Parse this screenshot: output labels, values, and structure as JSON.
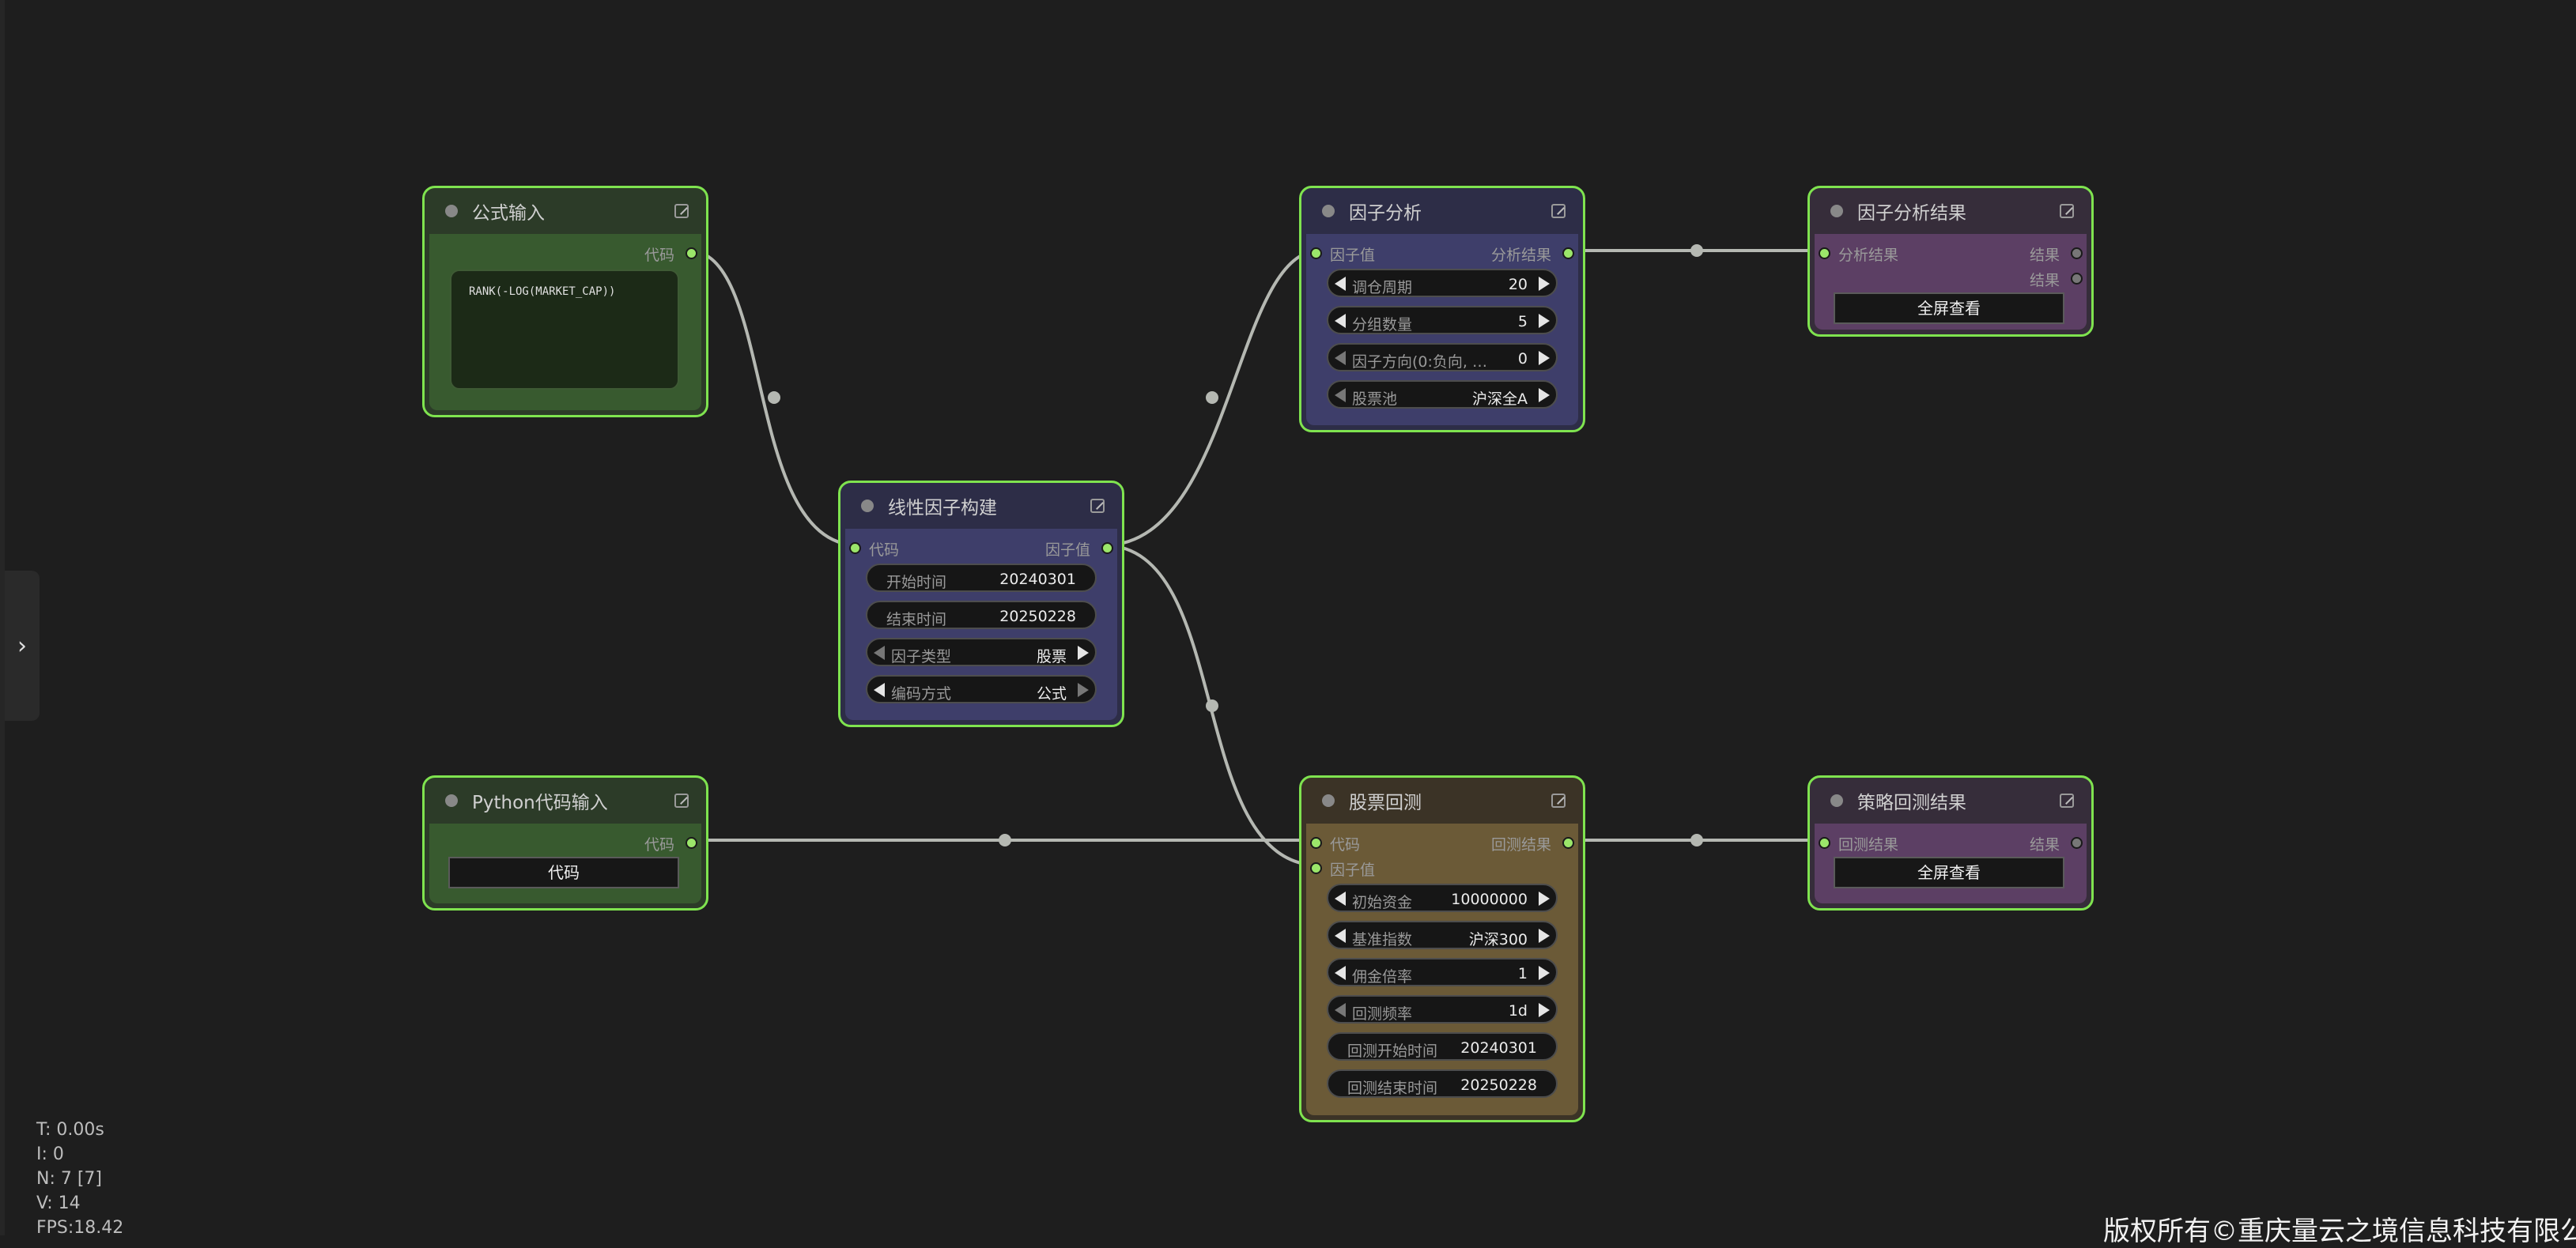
{
  "nodes": {
    "formula_input": {
      "title": "公式输入",
      "output_label": "代码",
      "formula_text": "RANK(-LOG(MARKET_CAP))"
    },
    "python_input": {
      "title": "Python代码输入",
      "output_label": "代码",
      "button_label": "代码"
    },
    "linear_factor": {
      "title": "线性因子构建",
      "input_label": "代码",
      "output_label": "因子值",
      "widgets": [
        {
          "label": "开始时间",
          "value": "20240301"
        },
        {
          "label": "结束时间",
          "value": "20250228"
        },
        {
          "label": "因子类型",
          "value": "股票"
        },
        {
          "label": "编码方式",
          "value": "公式"
        }
      ]
    },
    "factor_analysis": {
      "title": "因子分析",
      "input_label": "因子值",
      "output_label": "分析结果",
      "widgets": [
        {
          "label": "调仓周期",
          "value": "20"
        },
        {
          "label": "分组数量",
          "value": "5"
        },
        {
          "label": "因子方向(0:负向, …",
          "value": "0"
        },
        {
          "label": "股票池",
          "value": "沪深全A"
        }
      ]
    },
    "factor_result": {
      "title": "因子分析结果",
      "input_label": "分析结果",
      "output_label_1": "结果",
      "output_label_2": "结果",
      "button_label": "全屏查看"
    },
    "stock_backtest": {
      "title": "股票回测",
      "input_label_1": "代码",
      "input_label_2": "因子值",
      "output_label": "回测结果",
      "widgets": [
        {
          "label": "初始资金",
          "value": "10000000"
        },
        {
          "label": "基准指数",
          "value": "沪深300"
        },
        {
          "label": "佣金倍率",
          "value": "1"
        },
        {
          "label": "回测频率",
          "value": "1d"
        },
        {
          "label": "回测开始时间",
          "value": "20240301"
        },
        {
          "label": "回测结束时间",
          "value": "20250228"
        }
      ]
    },
    "strategy_result": {
      "title": "策略回测结果",
      "input_label": "回测结果",
      "output_label": "结果",
      "button_label": "全屏查看"
    }
  },
  "stats": {
    "t": "T: 0.00s",
    "i": "I: 0",
    "n": "N: 7 [7]",
    "v": "V: 14",
    "fps": "FPS:18.42"
  },
  "copyright": "版权所有©重庆量云之境信息科技有限公司",
  "colors": {
    "background": "#1e1e1e",
    "node_border": "#7fe34f",
    "input_node_title": "#2c3b28",
    "input_node_body": "#385a2f",
    "factor_node_title": "#2d2d47",
    "factor_node_body": "#3e3e6a",
    "result_node_title": "#362d3a",
    "result_node_body": "#5c3f64",
    "backtest_node_title": "#3b3326",
    "backtest_node_body": "#6b5a37",
    "link": "#b5b8b2"
  }
}
